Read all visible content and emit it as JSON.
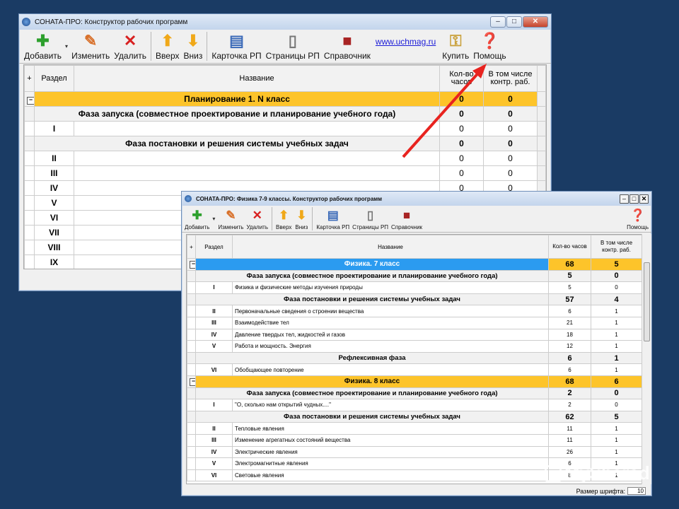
{
  "colors": {
    "background": "#1a3b64",
    "group_row": "#fdc42a",
    "subject_row": "#2b9bf0",
    "arrow": "#e8231f",
    "link": "#1c1cd8"
  },
  "window1": {
    "title": "СОНАТА-ПРО: Конструктор рабочих программ",
    "controls": {
      "minimize": "–",
      "maximize": "□",
      "close": "✕"
    },
    "toolbar": {
      "add": "Добавить",
      "edit": "Изменить",
      "delete": "Удалить",
      "up": "Вверх",
      "down": "Вниз",
      "card": "Карточка РП",
      "pages": "Страницы РП",
      "reference": "Справочник",
      "link": "www.uchmag.ru",
      "buy": "Купить",
      "help": "Помощь"
    },
    "columns": {
      "expand": "+",
      "section": "Раздел",
      "name": "Название",
      "hours": "Кол-во часов",
      "tests": "В том числе контр. раб."
    },
    "rows": [
      {
        "type": "group",
        "section": "",
        "name": "Планирование 1. N класс",
        "hours": "0",
        "tests": "0"
      },
      {
        "type": "phase",
        "section": "",
        "name": "Фаза запуска (совместное проектирование и  планирование учебного года)",
        "hours": "0",
        "tests": "0"
      },
      {
        "type": "item",
        "section": "I",
        "name": "",
        "hours": "0",
        "tests": "0"
      },
      {
        "type": "phase",
        "section": "",
        "name": "Фаза постановки и решения системы учебных задач",
        "hours": "0",
        "tests": "0"
      },
      {
        "type": "item",
        "section": "II",
        "name": "",
        "hours": "0",
        "tests": "0"
      },
      {
        "type": "item",
        "section": "III",
        "name": "",
        "hours": "0",
        "tests": "0"
      },
      {
        "type": "item",
        "section": "IV",
        "name": "",
        "hours": "0",
        "tests": "0"
      },
      {
        "type": "item",
        "section": "V",
        "name": "",
        "hours": "",
        "tests": ""
      },
      {
        "type": "item",
        "section": "VI",
        "name": "",
        "hours": "",
        "tests": ""
      },
      {
        "type": "item",
        "section": "VII",
        "name": "",
        "hours": "",
        "tests": ""
      },
      {
        "type": "item",
        "section": "VIII",
        "name": "",
        "hours": "",
        "tests": ""
      },
      {
        "type": "item",
        "section": "IX",
        "name": "",
        "hours": "",
        "tests": ""
      }
    ]
  },
  "window2": {
    "title": "СОНАТА-ПРО: Физика 7-9 классы. Конструктор рабочих программ",
    "controls": {
      "minimize": "–",
      "maximize": "□",
      "close": "✕"
    },
    "toolbar": {
      "add": "Добавить",
      "edit": "Изменить",
      "delete": "Удалить",
      "up": "Вверх",
      "down": "Вниз",
      "card": "Карточка РП",
      "pages": "Страницы РП",
      "reference": "Справочник",
      "help": "Помощь"
    },
    "columns": {
      "expand": "+",
      "section": "Раздел",
      "name": "Название",
      "hours": "Кол-во часов",
      "tests": "В том числе контр. раб."
    },
    "rows": [
      {
        "type": "subject",
        "section": "",
        "name": "Физика. 7 класс",
        "hours": "68",
        "tests": "5"
      },
      {
        "type": "phase",
        "section": "",
        "name": "Фаза запуска (совместное проектирование и  планирование учебного года)",
        "hours": "5",
        "tests": "0"
      },
      {
        "type": "item",
        "section": "I",
        "name": "Физика и физические методы изучения природы",
        "hours": "5",
        "tests": "0"
      },
      {
        "type": "phase",
        "section": "",
        "name": "Фаза постановки и решения системы учебных задач",
        "hours": "57",
        "tests": "4"
      },
      {
        "type": "item",
        "section": "II",
        "name": "Первоначальные сведения о строении вещества",
        "hours": "6",
        "tests": "1"
      },
      {
        "type": "item",
        "section": "III",
        "name": "Взаимодействие тел",
        "hours": "21",
        "tests": "1"
      },
      {
        "type": "item",
        "section": "IV",
        "name": "Давление твердых тел, жидкостей и газов",
        "hours": "18",
        "tests": "1"
      },
      {
        "type": "item",
        "section": "V",
        "name": "Работа и мощность. Энергия",
        "hours": "12",
        "tests": "1"
      },
      {
        "type": "phase",
        "section": "",
        "name": "Рефлексивная фаза",
        "hours": "6",
        "tests": "1"
      },
      {
        "type": "item",
        "section": "VI",
        "name": "Обобщающее повторение",
        "hours": "6",
        "tests": "1"
      },
      {
        "type": "group",
        "section": "",
        "name": "Физика. 8 класс",
        "hours": "68",
        "tests": "6"
      },
      {
        "type": "phase",
        "section": "",
        "name": "Фаза запуска (совместное проектирование и  планирование учебного года)",
        "hours": "2",
        "tests": "0"
      },
      {
        "type": "item",
        "section": "I",
        "name": "\"О, сколько нам открытий чудных....\"",
        "hours": "2",
        "tests": "0"
      },
      {
        "type": "phase",
        "section": "",
        "name": "Фаза постановки и решения системы учебных задач",
        "hours": "62",
        "tests": "5"
      },
      {
        "type": "item",
        "section": "II",
        "name": "Тепловые явления",
        "hours": "11",
        "tests": "1"
      },
      {
        "type": "item",
        "section": "III",
        "name": "Изменение агрегатных состояний вещества",
        "hours": "11",
        "tests": "1"
      },
      {
        "type": "item",
        "section": "IV",
        "name": "Электрические явления",
        "hours": "26",
        "tests": "1"
      },
      {
        "type": "item",
        "section": "V",
        "name": "Электромагнитные явления",
        "hours": "6",
        "tests": "1"
      },
      {
        "type": "item",
        "section": "VI",
        "name": "Световые явления",
        "hours": "8",
        "tests": "1"
      }
    ],
    "status": {
      "font_size_label": "Размер шрифта:",
      "font_size_value": "10"
    }
  },
  "watermark": "MyShared"
}
